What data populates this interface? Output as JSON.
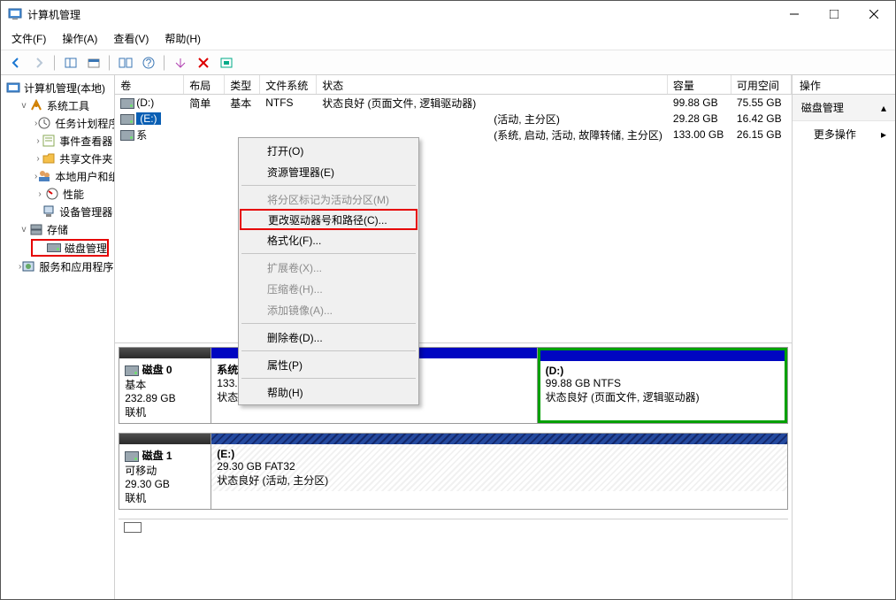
{
  "window": {
    "title": "计算机管理"
  },
  "menu": {
    "file": "文件(F)",
    "action": "操作(A)",
    "view": "查看(V)",
    "help": "帮助(H)"
  },
  "tree": {
    "root": "计算机管理(本地)",
    "tools": "系统工具",
    "tasks": "任务计划程序",
    "events": "事件查看器",
    "shares": "共享文件夹",
    "users": "本地用户和组",
    "perf": "性能",
    "devmgr": "设备管理器",
    "storage": "存储",
    "diskmgmt": "磁盘管理",
    "services": "服务和应用程序"
  },
  "grid": {
    "headers": {
      "vol": "卷",
      "layout": "布局",
      "type": "类型",
      "fs": "文件系统",
      "status": "状态",
      "cap": "容量",
      "free": "可用空间"
    },
    "rows": [
      {
        "vol": "(D:)",
        "layout": "简单",
        "type": "基本",
        "fs": "NTFS",
        "status": "状态良好 (页面文件, 逻辑驱动器)",
        "cap": "99.88 GB",
        "free": "75.55 GB"
      },
      {
        "vol": "(E:)",
        "layout": "",
        "type": "",
        "fs": "",
        "status": "(活动, 主分区)",
        "cap": "29.28 GB",
        "free": "16.42 GB"
      },
      {
        "vol": "系",
        "layout": "",
        "type": "",
        "fs": "",
        "status": "(系统, 启动, 活动, 故障转储, 主分区)",
        "cap": "133.00 GB",
        "free": "26.15 GB"
      }
    ]
  },
  "disks": {
    "d0": {
      "name": "磁盘 0",
      "type": "基本",
      "size": "232.89 GB",
      "state": "联机",
      "p1": {
        "title": "系统  (C:)",
        "line2": "133.00 GB NTFS",
        "line3": "状态良好 (系统, 启动, 活动, 故障转储, 主"
      },
      "p2": {
        "title": " (D:)",
        "line2": "99.88 GB NTFS",
        "line3": "状态良好 (页面文件, 逻辑驱动器)"
      }
    },
    "d1": {
      "name": "磁盘 1",
      "type": "可移动",
      "size": "29.30 GB",
      "state": "联机",
      "p1": {
        "title": " (E:)",
        "line2": "29.30 GB FAT32",
        "line3": "状态良好 (活动, 主分区)"
      }
    }
  },
  "actions": {
    "header": "操作",
    "title": "磁盘管理",
    "more": "更多操作"
  },
  "context": {
    "open": "打开(O)",
    "explorer": "资源管理器(E)",
    "active": "将分区标记为活动分区(M)",
    "change": "更改驱动器号和路径(C)...",
    "format": "格式化(F)...",
    "extend": "扩展卷(X)...",
    "shrink": "压缩卷(H)...",
    "mirror": "添加镜像(A)...",
    "delete": "删除卷(D)...",
    "props": "属性(P)",
    "help": "帮助(H)"
  }
}
